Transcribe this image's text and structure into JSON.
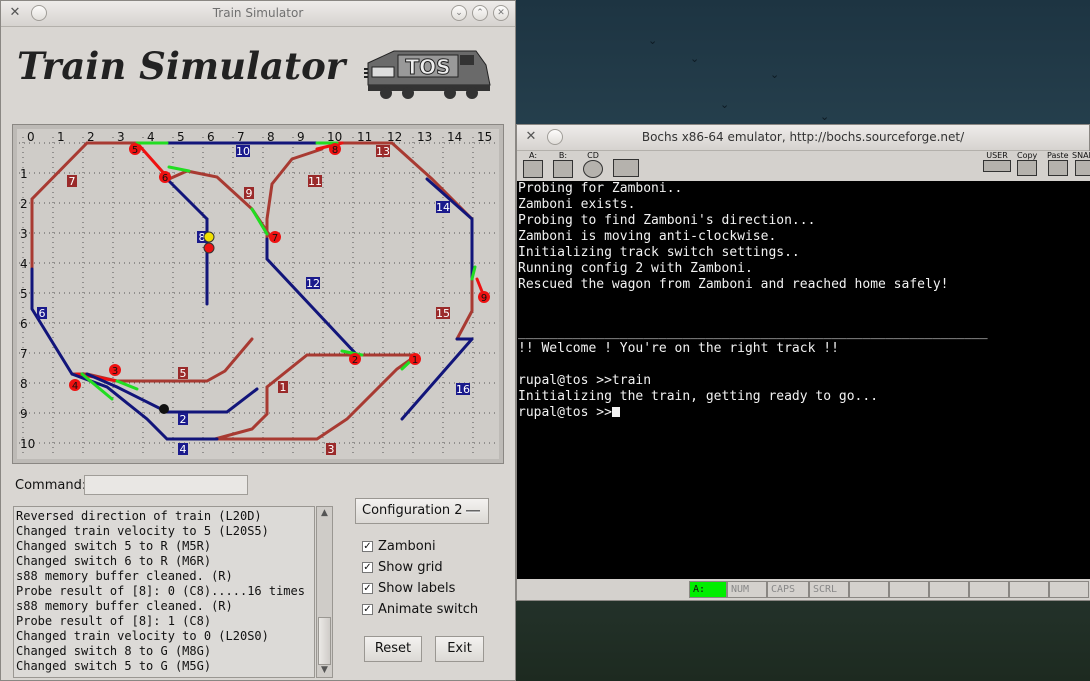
{
  "colors": {
    "track_red": "#a83a32",
    "track_blue": "#12157a",
    "switch_green": "#22dd22",
    "switch_red": "#ee1111",
    "sensor_red": "#ee1111",
    "label_blue": "#1a1a8c",
    "label_red": "#9a2a2a",
    "train_yellow": "#f0e000",
    "status_green": "#00ee00"
  },
  "sim_window": {
    "title": "Train Simulator",
    "app_title": "Train Simulator",
    "logo_text": "TOS",
    "grid_cols": [
      "0",
      "1",
      "2",
      "3",
      "4",
      "5",
      "6",
      "7",
      "8",
      "9",
      "10",
      "11",
      "12",
      "13",
      "14",
      "15"
    ],
    "grid_rows": [
      "1",
      "2",
      "3",
      "4",
      "5",
      "6",
      "7",
      "8",
      "9",
      "10"
    ],
    "segment_labels": [
      {
        "text": "1",
        "color": "label_red"
      },
      {
        "text": "2",
        "color": "label_blue"
      },
      {
        "text": "3",
        "color": "label_red"
      },
      {
        "text": "4",
        "color": "label_blue"
      },
      {
        "text": "5",
        "color": "label_red"
      },
      {
        "text": "6",
        "color": "label_blue"
      },
      {
        "text": "7",
        "color": "label_red"
      },
      {
        "text": "8",
        "color": "label_blue"
      },
      {
        "text": "9",
        "color": "label_red"
      },
      {
        "text": "10",
        "color": "label_blue"
      },
      {
        "text": "11",
        "color": "label_red"
      },
      {
        "text": "12",
        "color": "label_blue"
      },
      {
        "text": "13",
        "color": "label_red"
      },
      {
        "text": "14",
        "color": "label_blue"
      },
      {
        "text": "15",
        "color": "label_red"
      },
      {
        "text": "16",
        "color": "label_blue"
      }
    ],
    "switch_markers": [
      "1",
      "2",
      "3",
      "4",
      "5",
      "6",
      "7",
      "8",
      "9"
    ],
    "command_label": "Command:",
    "command_value": "",
    "log_lines": [
      "Reversed direction of train (L20D)",
      "Changed train velocity to 5 (L20S5)",
      "Changed switch 5 to R (M5R)",
      "Changed switch 6 to R (M6R)",
      "s88 memory buffer cleaned. (R)",
      "Probe result of [8]: 0 (C8).....16 times",
      "s88 memory buffer cleaned. (R)",
      "Probe result of [8]: 1 (C8)",
      "Changed train velocity to 0 (L20S0)",
      "Changed switch 8 to G (M8G)",
      "Changed switch 5 to G (M5G)"
    ],
    "configuration_selected": "Configuration 2",
    "checkboxes": [
      {
        "label": "Zamboni",
        "checked": true
      },
      {
        "label": "Show grid",
        "checked": true
      },
      {
        "label": "Show labels",
        "checked": true
      },
      {
        "label": "Animate switch",
        "checked": true
      }
    ],
    "reset_label": "Reset",
    "exit_label": "Exit"
  },
  "bochs_window": {
    "title": "Bochs x86-64 emulator, http://bochs.sourceforge.net/",
    "toolbar_left": [
      {
        "label": "A:",
        "icon": "floppy-a-icon"
      },
      {
        "label": "B:",
        "icon": "floppy-b-icon"
      },
      {
        "label": "CD",
        "icon": "cdrom-icon"
      },
      {
        "label": "",
        "icon": "mouse-icon"
      }
    ],
    "toolbar_right": [
      {
        "label": "USER",
        "icon": "keyboard-icon"
      },
      {
        "label": "Copy",
        "icon": "copy-icon"
      },
      {
        "label": "Paste",
        "icon": "paste-icon"
      },
      {
        "label": "SNAP",
        "icon": "snapshot-icon"
      }
    ],
    "console_lines": [
      "Probing for Zamboni..",
      "Zamboni exists.",
      "Probing to find Zamboni's direction...",
      "Zamboni is moving anti-clockwise.",
      "Initializing track switch settings..",
      "Running config 2 with Zamboni.",
      "Rescued the wagon from Zamboni and reached home safely!",
      "",
      "",
      "____________________________________________________________",
      "!! Welcome ! You're on the right track !!",
      "",
      "rupal@tos >>train",
      "Initializing the train, getting ready to go...",
      "rupal@tos >>"
    ],
    "status_items": [
      "A:",
      "NUM",
      "CAPS",
      "SCRL"
    ]
  }
}
